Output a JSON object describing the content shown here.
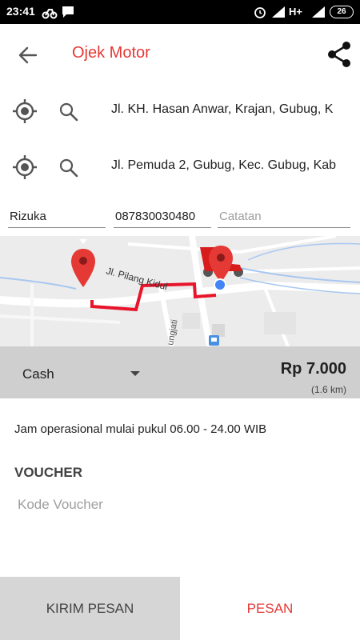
{
  "status_bar": {
    "time": "23:41",
    "network": "H+",
    "battery": "26"
  },
  "toolbar": {
    "title": "Ojek Motor",
    "back_icon": "arrow-left-icon",
    "share_icon": "share-icon"
  },
  "addresses": {
    "origin": "Jl. KH. Hasan Anwar, Krajan, Gubug, K",
    "destination": "Jl. Pemuda 2, Gubug, Kec. Gubug, Kab"
  },
  "form": {
    "name_value": "Rizuka",
    "phone_value": "087830030480",
    "notes_placeholder": "Catatan"
  },
  "map": {
    "street_label_1": "Jl. Pilang Kidul",
    "street_label_2": "ungjati"
  },
  "payment": {
    "method": "Cash",
    "price": "Rp 7.000",
    "distance": "(1.6 km)"
  },
  "info": {
    "hours": "Jam operasional mulai pukul 06.00 - 24.00 WIB"
  },
  "voucher": {
    "label": "VOUCHER",
    "placeholder": "Kode Voucher"
  },
  "buttons": {
    "send_message": "KIRIM PESAN",
    "order": "PESAN"
  },
  "colors": {
    "accent": "#e53935",
    "route": "#e8142a",
    "pay_bar": "#cfcfcf"
  }
}
